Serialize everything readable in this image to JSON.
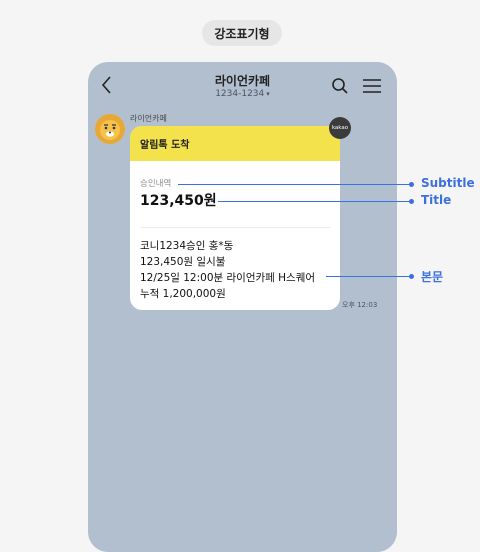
{
  "page": {
    "type_label": "강조표기형"
  },
  "chat": {
    "title": "라이언카페",
    "phone": "1234-1234",
    "caret": "▾",
    "sender": "라이언카페",
    "kakao_badge": "kakao",
    "time": "오후 12:03"
  },
  "card": {
    "header": "알림톡 도착",
    "subtitle": "승인내역",
    "title": "123,450원",
    "body": [
      "코니1234승인 홍*동",
      "123,450원 일시불",
      "12/25일 12:00분 라이언카페 H스퀘어",
      "누적 1,200,000원"
    ]
  },
  "annotations": {
    "subtitle": "Subtitle",
    "title": "Title",
    "body": "본문"
  },
  "colors": {
    "chat_bg": "#b1bfcf",
    "card_header": "#f4e24c",
    "annotation": "#3c6fe0"
  }
}
